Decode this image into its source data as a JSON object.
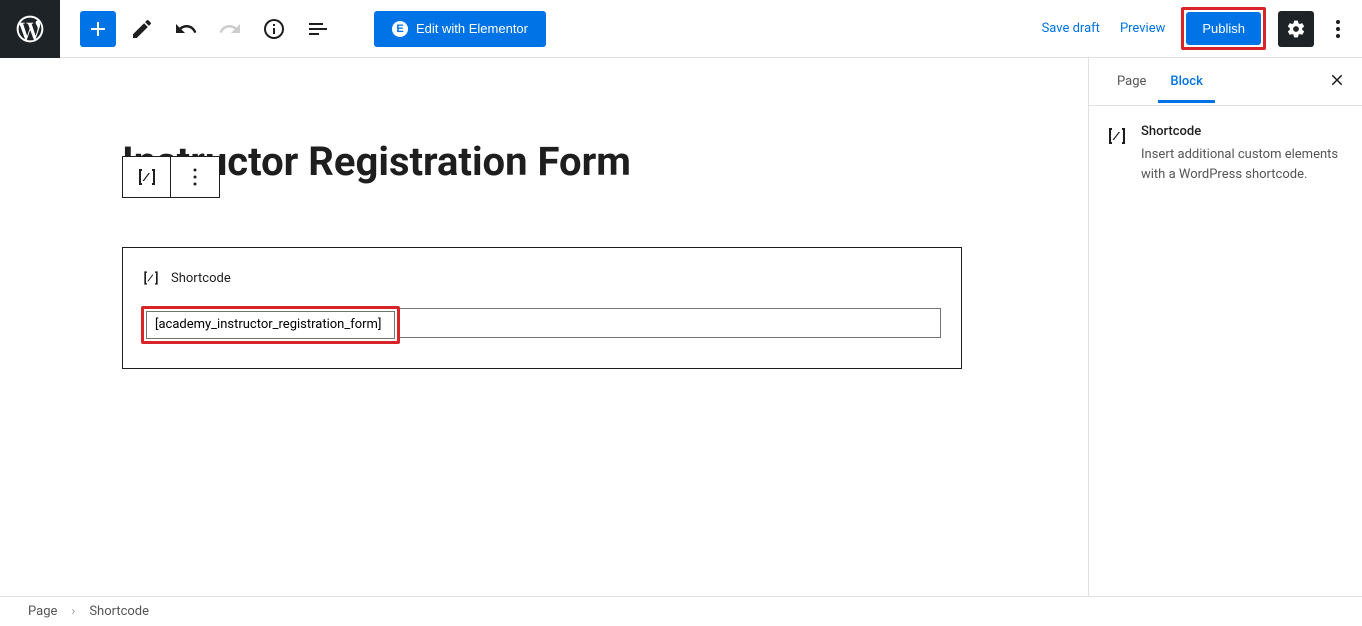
{
  "header": {
    "elementor_label": "Edit with Elementor",
    "save_draft": "Save draft",
    "preview": "Preview",
    "publish": "Publish"
  },
  "editor": {
    "page_title": "Instructor Registration Form",
    "block": {
      "label": "Shortcode",
      "value": "[academy_instructor_registration_form]"
    }
  },
  "sidebar": {
    "tab_page": "Page",
    "tab_block": "Block",
    "block_name": "Shortcode",
    "block_desc": "Insert additional custom elements with a WordPress shortcode."
  },
  "footer": {
    "crumb1": "Page",
    "crumb2": "Shortcode"
  }
}
